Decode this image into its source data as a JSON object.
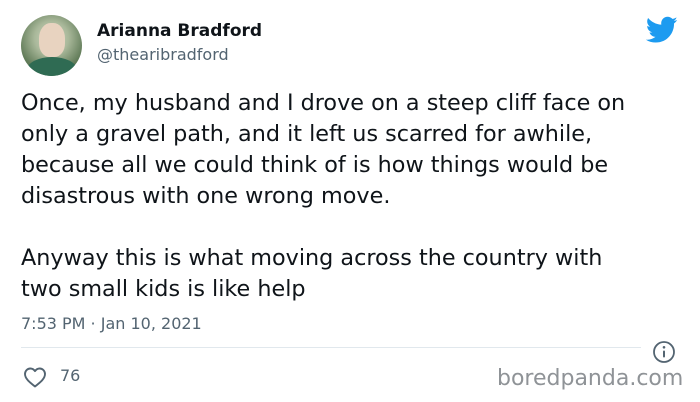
{
  "author": {
    "name": "Arianna Bradford",
    "handle": "@thearibradford"
  },
  "tweet": {
    "lines_para1": [
      "Once, my husband and I drove on a steep cliff face on",
      "only a gravel path, and it left us scarred for awhile,",
      "because all we could think of is how things would be",
      "disastrous with one wrong move."
    ],
    "lines_para2": [
      "Anyway this is what moving across the country with",
      "two small kids is like help"
    ],
    "timestamp": "7:53 PM · Jan 10, 2021"
  },
  "stats": {
    "likes": "76"
  },
  "watermark": "boredpanda.com",
  "colors": {
    "twitter_blue": "#1d9bf0",
    "secondary_text": "#536471",
    "divider": "#e1e8ed"
  },
  "icons": {
    "brand": "twitter-bird-icon",
    "info": "info-icon",
    "like": "heart-icon"
  }
}
